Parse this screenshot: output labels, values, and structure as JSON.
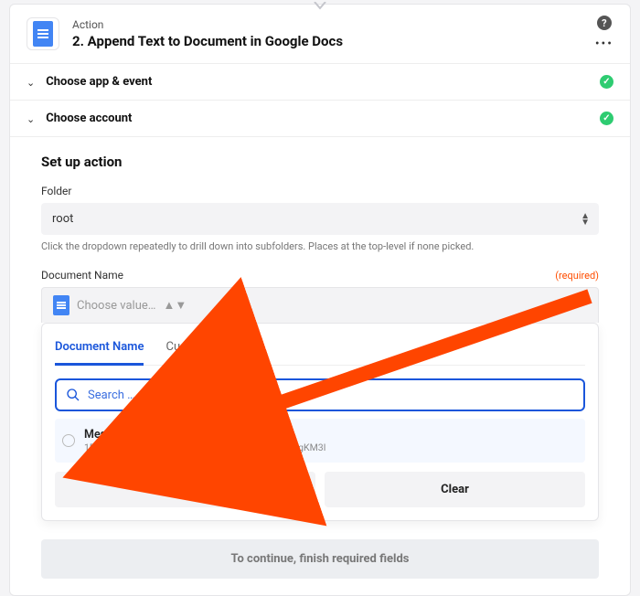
{
  "header": {
    "subtitle": "Action",
    "title": "2. Append Text to Document in Google Docs"
  },
  "sections": {
    "appEvent": "Choose app & event",
    "account": "Choose account",
    "setup": "Set up action"
  },
  "folder": {
    "label": "Folder",
    "value": "root",
    "helper": "Click the dropdown repeatedly to drill down into subfolders. Places at the top-level if none picked."
  },
  "documentName": {
    "label": "Document Name",
    "required": "(required)",
    "placeholder": "Choose value…"
  },
  "dropdown": {
    "tabs": {
      "primary": "Document Name",
      "secondary": "Custom"
    },
    "searchPlaceholder": "Search …",
    "option": {
      "title": "Messages from Slack",
      "sub": "1EJMAHlWdboPEcSe2n-cJm7NXoh6Sro8tCbLah5gKM3I"
    },
    "loadMore": "Load More",
    "clear": "Clear"
  },
  "footer": {
    "continue": "To continue, finish required fields"
  }
}
